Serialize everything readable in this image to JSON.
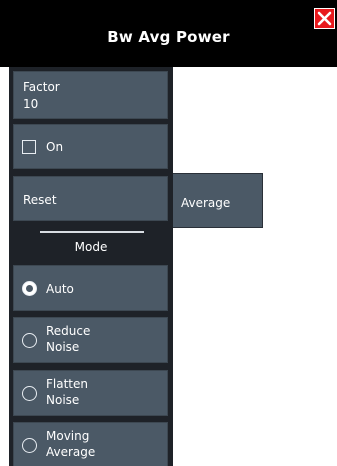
{
  "window": {
    "title": "Bw Avg Power"
  },
  "icons": {
    "close": "close-icon"
  },
  "controls": {
    "factor_label": "Factor",
    "factor_value": "10",
    "on_label": "On",
    "reset_label": "Reset",
    "average_tab": "Average"
  },
  "mode": {
    "title": "Mode",
    "options": [
      {
        "line1": "Auto",
        "line2": "",
        "selected": true
      },
      {
        "line1": "Reduce",
        "line2": "Noise",
        "selected": false
      },
      {
        "line1": "Flatten",
        "line2": "Noise",
        "selected": false
      },
      {
        "line1": "Moving",
        "line2": "Average",
        "selected": false
      }
    ]
  },
  "colors": {
    "titlebar": "#000000",
    "panel": "#1e2228",
    "button": "#4b5966",
    "close": "#e8191d"
  }
}
